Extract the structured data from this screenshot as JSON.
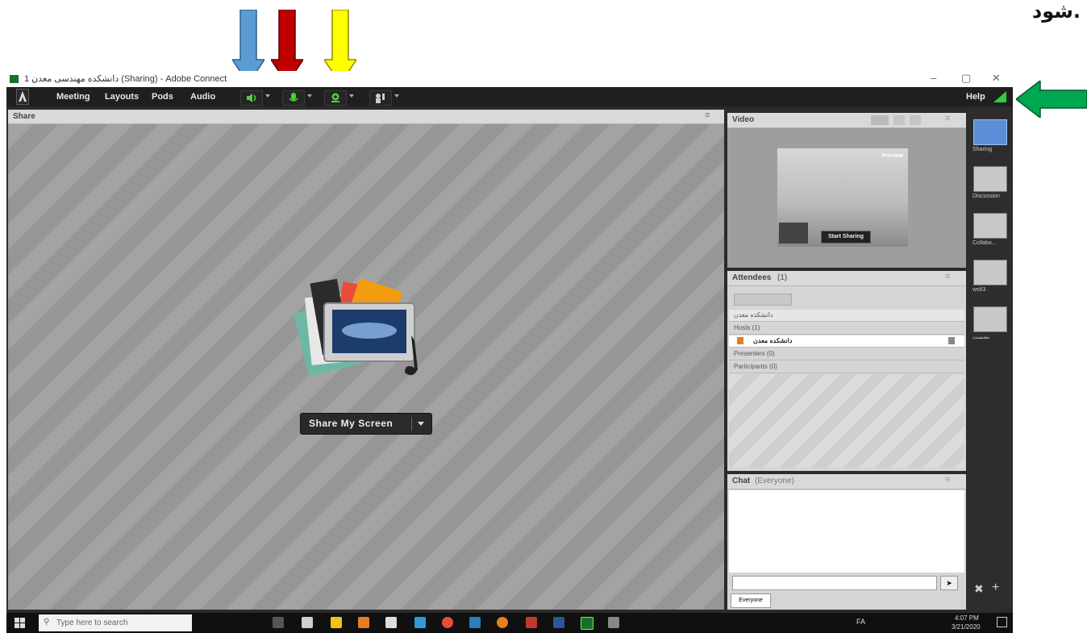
{
  "corner_text": "شود.",
  "window": {
    "title": "دانشکده مهندسی معدن 1 (Sharing) - Adobe Connect",
    "controls": {
      "minimize": "–",
      "restore": "▢",
      "close": "✕"
    }
  },
  "menubar": {
    "items": [
      "Meeting",
      "Layouts",
      "Pods",
      "Audio"
    ],
    "help": "Help"
  },
  "share_pod": {
    "title": "Share",
    "button_label": "Share My Screen"
  },
  "video_pod": {
    "title": "Video",
    "preview_label": "Preview",
    "start_sharing_label": "Start Sharing"
  },
  "attendees_pod": {
    "title": "Attendees",
    "count": "(1)",
    "me_name": "دانشکده معدن",
    "hosts_label": "Hosts (1)",
    "host_name": "دانشکده معدن",
    "presenters_label": "Presenters (0)",
    "participants_label": "Participants (0)"
  },
  "chat_pod": {
    "title": "Chat",
    "scope": "(Everyone)",
    "tab": "Everyone"
  },
  "layouts": [
    "Sharing",
    "Discussion",
    "Collabo...",
    "ws63",
    "نشست"
  ],
  "taskbar": {
    "search_placeholder": "Type here to search",
    "time": "4:07 PM",
    "date": "3/21/2020",
    "lang": "FA"
  },
  "colors": {
    "arrow_blue": "#5b9bd5",
    "arrow_red": "#c00000",
    "arrow_yellow": "#ffff00",
    "arrow_green": "#00a650",
    "connection_green": "#2ecc40"
  }
}
